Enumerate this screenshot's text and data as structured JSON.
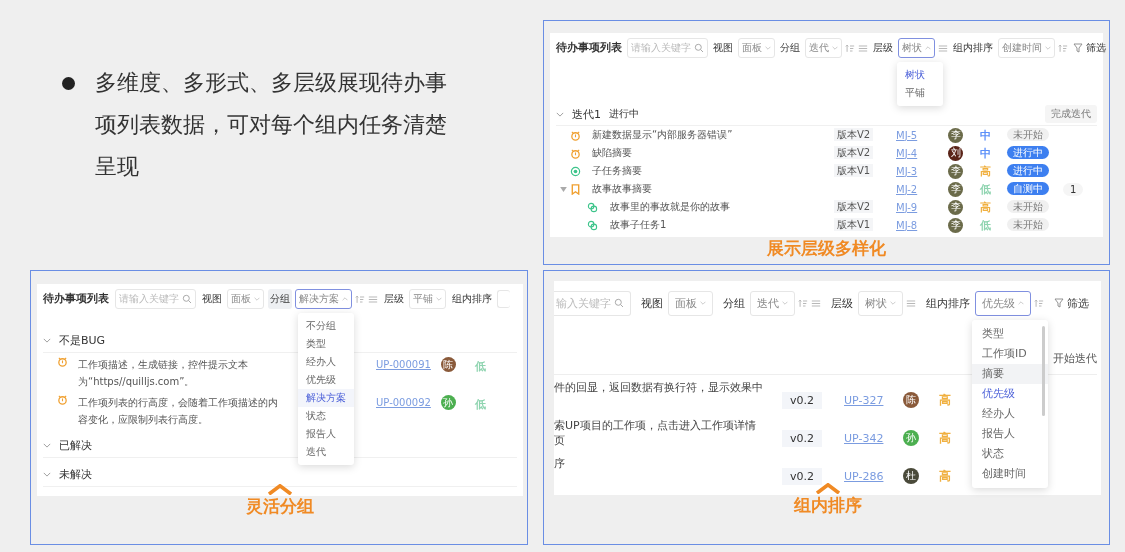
{
  "bullet": "多维度、多形式、多层级展现待办事项列表数据，可对每个组内任务清楚呈现",
  "panels": [
    {
      "kind": "tree",
      "caption": "展示层级多样化",
      "caption_chevron": false,
      "toolbar": {
        "title": "待办事项列表",
        "search": "请输入关键字",
        "filter_button": "筛选",
        "filters": [
          {
            "label": "视图",
            "value": "面板",
            "open": false,
            "highlighted": false
          },
          {
            "label": "分组",
            "value": "迭代",
            "open": false,
            "highlighted": false,
            "icons": [
              {
                "kind": "sort"
              },
              {
                "kind": "list"
              }
            ]
          },
          {
            "label": "层级",
            "value": "树状",
            "open": true,
            "highlighted": false,
            "icons": [
              {
                "kind": "list"
              }
            ],
            "options": [
              {
                "label": "树状",
                "selected": true,
                "hovered": false
              },
              {
                "label": "平铺",
                "selected": false,
                "hovered": false
              }
            ]
          },
          {
            "label": "组内排序",
            "value": "创建时间",
            "open": false,
            "highlighted": false,
            "icons": [
              {
                "kind": "sort"
              }
            ]
          }
        ]
      },
      "group": {
        "name": "迭代1",
        "status": "进行中",
        "action": "完成迭代"
      },
      "rows": [
        {
          "kind": "bug",
          "title": "新建数据显示“内部服务器错误”",
          "version": "版本V2",
          "id": "MJ-5",
          "avatar": {
            "letter": "李",
            "color": "#6b6b4a"
          },
          "priority": {
            "label": "中",
            "color": "#5b8ff9"
          },
          "status": "未开始",
          "status_active": false
        },
        {
          "kind": "bug",
          "title": "缺陷摘要",
          "version": "版本V2",
          "id": "MJ-4",
          "avatar": {
            "letter": "刘",
            "color": "#5a2418"
          },
          "priority": {
            "label": "中",
            "color": "#5b8ff9"
          },
          "status": "进行中",
          "status_active": true
        },
        {
          "kind": "subtask",
          "title": "子任务摘要",
          "version": "版本V1",
          "id": "MJ-3",
          "avatar": {
            "letter": "李",
            "color": "#6b6b4a"
          },
          "priority": {
            "label": "高",
            "color": "#f0b040"
          },
          "status": "进行中",
          "status_active": true
        },
        {
          "kind": "story",
          "title": "故事故事摘要",
          "id": "MJ-2",
          "avatar": {
            "letter": "李",
            "color": "#6b6b4a"
          },
          "priority": {
            "label": "低",
            "color": "#8fd4b0"
          },
          "status": "自测中",
          "status_active": true,
          "count": "1",
          "expanded": true,
          "children": [
            {
              "kind": "linked",
              "title": "故事里的事故就是你的故事",
              "version": "版本V2",
              "id": "MJ-9",
              "avatar": {
                "letter": "李",
                "color": "#6b6b4a"
              },
              "priority": {
                "label": "高",
                "color": "#f0b040"
              },
              "status": "未开始",
              "status_active": false
            },
            {
              "kind": "linked",
              "title": "故事子任务1",
              "version": "版本V1",
              "id": "MJ-8",
              "avatar": {
                "letter": "李",
                "color": "#6b6b4a"
              },
              "priority": {
                "label": "低",
                "color": "#8fd4b0"
              },
              "status": "未开始",
              "status_active": false
            }
          ]
        }
      ]
    },
    {
      "kind": "grouped",
      "caption": "灵活分组",
      "caption_chevron": true,
      "toolbar": {
        "title": "待办事项列表",
        "search": "请输入关键字",
        "filters": [
          {
            "label": "视图",
            "value": "面板",
            "open": false,
            "highlighted": false
          },
          {
            "label": "分组",
            "value": "解决方案",
            "open": true,
            "highlighted": true,
            "icons": [
              {
                "kind": "sort"
              },
              {
                "kind": "list"
              }
            ],
            "options": [
              {
                "label": "不分组",
                "selected": false,
                "hovered": false
              },
              {
                "label": "类型",
                "selected": false,
                "hovered": false
              },
              {
                "label": "经办人",
                "selected": false,
                "hovered": false
              },
              {
                "label": "优先级",
                "selected": false,
                "hovered": false
              },
              {
                "label": "解决方案",
                "selected": true,
                "hovered": false
              },
              {
                "label": "状态",
                "selected": false,
                "hovered": false
              },
              {
                "label": "报告人",
                "selected": false,
                "hovered": false
              },
              {
                "label": "迭代",
                "selected": false,
                "hovered": false
              }
            ]
          },
          {
            "label": "层级",
            "value": "平铺",
            "open": false,
            "highlighted": false
          },
          {
            "label": "组内排序",
            "open": false,
            "highlighted": false
          }
        ]
      },
      "groups": [
        {
          "name": "不是BUG",
          "rows": [
            {
              "kind": "bug",
              "title": "工作项描述，生成链接，控件提示文本为“https//quilljs.com”。",
              "id": "UP-000091",
              "avatar": {
                "letter": "陈",
                "color": "#8a5a3a"
              },
              "priority": {
                "label": "低",
                "color": "#8fd4b0"
              }
            },
            {
              "kind": "bug",
              "title": "工作项列表的行高度，会随着工作项描述的内容变化，应限制列表行高度。",
              "id": "UP-000092",
              "avatar": {
                "letter": "孙",
                "color": "#4caf50"
              },
              "priority": {
                "label": "低",
                "color": "#8fd4b0"
              }
            }
          ]
        },
        {
          "name": "已解决"
        },
        {
          "name": "未解决"
        }
      ]
    },
    {
      "kind": "sorted",
      "caption": "组内排序",
      "caption_chevron": true,
      "toolbar": {
        "search": "输入关键字",
        "filter_button": "筛选",
        "filters": [
          {
            "label": "视图",
            "value": "面板",
            "open": false,
            "highlighted": false
          },
          {
            "label": "分组",
            "value": "迭代",
            "open": false,
            "highlighted": false,
            "icons": [
              {
                "kind": "sort"
              },
              {
                "kind": "list"
              }
            ]
          },
          {
            "label": "层级",
            "value": "树状",
            "open": false,
            "highlighted": false,
            "icons": [
              {
                "kind": "list"
              }
            ]
          },
          {
            "label": "组内排序",
            "value": "优先级",
            "open": true,
            "highlighted": false,
            "icons": [
              {
                "kind": "sort"
              }
            ],
            "options": [
              {
                "label": "类型",
                "selected": false,
                "hovered": false
              },
              {
                "label": "工作项ID",
                "selected": false,
                "hovered": false
              },
              {
                "label": "摘要",
                "selected": false,
                "hovered": true
              },
              {
                "label": "优先级",
                "selected": true,
                "hovered": false
              },
              {
                "label": "经办人",
                "selected": false,
                "hovered": false
              },
              {
                "label": "报告人",
                "selected": false,
                "hovered": false
              },
              {
                "label": "状态",
                "selected": false,
                "hovered": false
              },
              {
                "label": "创建时间",
                "selected": false,
                "hovered": false
              }
            ]
          }
        ]
      },
      "group_action": "开始迭代",
      "rows": [
        {
          "title": "件的回显，返回数据有换行符，显示效果中",
          "version": "v0.2",
          "id": "UP-327",
          "avatar": {
            "letter": "陈",
            "color": "#8a5a3a"
          },
          "priority": {
            "label": "高",
            "color": "#f0b040"
          }
        },
        {
          "title": "索UP项目的工作项，点击进入工作项详情页",
          "version": "v0.2",
          "id": "UP-342",
          "avatar": {
            "letter": "孙",
            "color": "#4caf50"
          },
          "priority": {
            "label": "高",
            "color": "#f0b040"
          }
        },
        {
          "title": "序",
          "version": "v0.2",
          "id": "UP-286",
          "avatar": {
            "letter": "杜",
            "color": "#4a4a3a"
          },
          "priority": {
            "label": "高",
            "color": "#f0b040"
          }
        }
      ]
    }
  ]
}
